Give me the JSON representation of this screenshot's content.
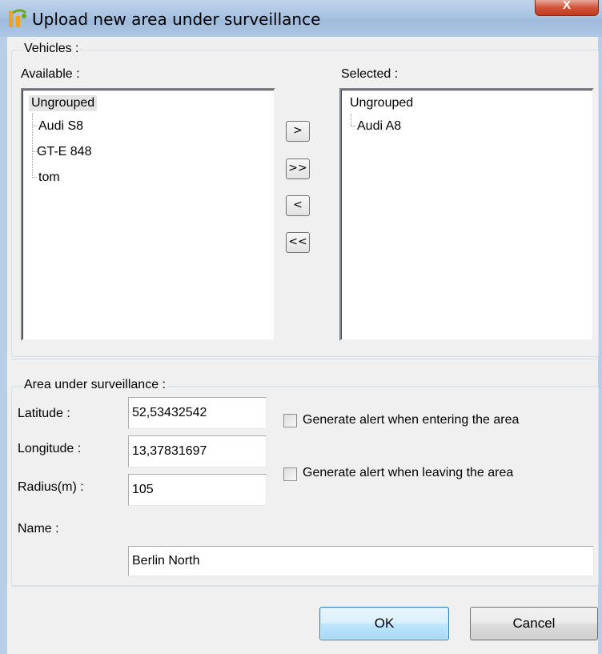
{
  "window": {
    "title": "Upload new area under surveillance",
    "close_label": "X"
  },
  "vehicles": {
    "group_label": "Vehicles :",
    "available_label": "Available :",
    "selected_label": "Selected :",
    "available": {
      "root": "Ungrouped",
      "items": [
        "Audi S8",
        "GT-E 848",
        "tom"
      ]
    },
    "selected": {
      "root": "Ungrouped",
      "items": [
        "Audi A8"
      ]
    },
    "buttons": {
      "add": ">",
      "add_all": ">>",
      "remove": "<",
      "remove_all": "<<"
    }
  },
  "area": {
    "group_label": "Area under surveillance :",
    "latitude_label": "Latitude :",
    "latitude_value": "52,53432542",
    "longitude_label": "Longitude :",
    "longitude_value": "13,37831697",
    "radius_label": "Radius(m) :",
    "radius_value": "105",
    "name_label": "Name :",
    "name_value": "Berlin North",
    "alert_enter_label": "Generate alert when entering the area",
    "alert_enter_checked": false,
    "alert_leave_label": "Generate alert when leaving the area",
    "alert_leave_checked": false
  },
  "footer": {
    "ok_label": "OK",
    "cancel_label": "Cancel"
  }
}
